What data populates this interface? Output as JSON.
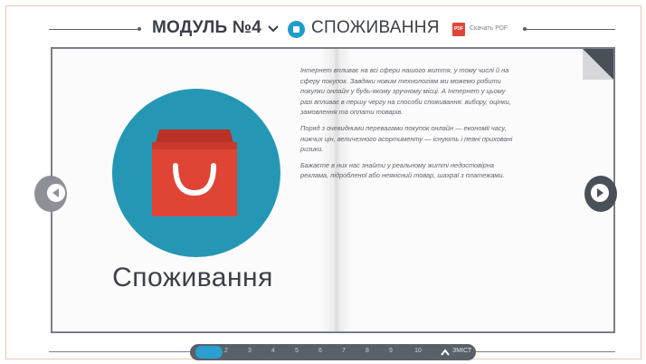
{
  "header": {
    "module_title": "МОДУЛЬ №4",
    "section_title": "СПОЖИВАННЯ",
    "pdf_icon_text": "PDF",
    "pdf_link": "Скачать PDF"
  },
  "book": {
    "left_page": {
      "title": "Споживання"
    },
    "right_page": {
      "paragraphs": [
        "Інтернет впливає на всі сфери нашого життя, у тому числі й на сферу покупок. Завдяки новим технологіям ми можемо робити покупки онлайн у будь-якому зручному місці. А Інтернет у цьому разі впливає в першу чергу на способи споживання: вибору, оцінки, замовлення та оплати товарів.",
        "Поряд з очевидними перевагами покупок онлайн — економії часу, нижчих цін, величезного асортименту — існують і певні приховані ризики.",
        "Бажаєте в них нас знайти у реальному житті недостовірна реклама, підробленої або неякісний товар, шахраї з платежами."
      ]
    }
  },
  "pager": {
    "pages": [
      "1",
      "2",
      "3",
      "4",
      "5",
      "6",
      "7",
      "8",
      "9",
      "10"
    ],
    "active_page": "1",
    "menu_label": "ЗМІСТ"
  },
  "colors": {
    "accent_blue": "#2597b5",
    "bag_red": "#e04434",
    "pager_bg": "#5a6068",
    "pdf_red": "#e0453a"
  },
  "icons": [
    "chevron-down-icon",
    "shopping-bag-icon",
    "pdf-icon",
    "prev-arrow-icon",
    "next-arrow-icon",
    "chevron-up-icon"
  ]
}
